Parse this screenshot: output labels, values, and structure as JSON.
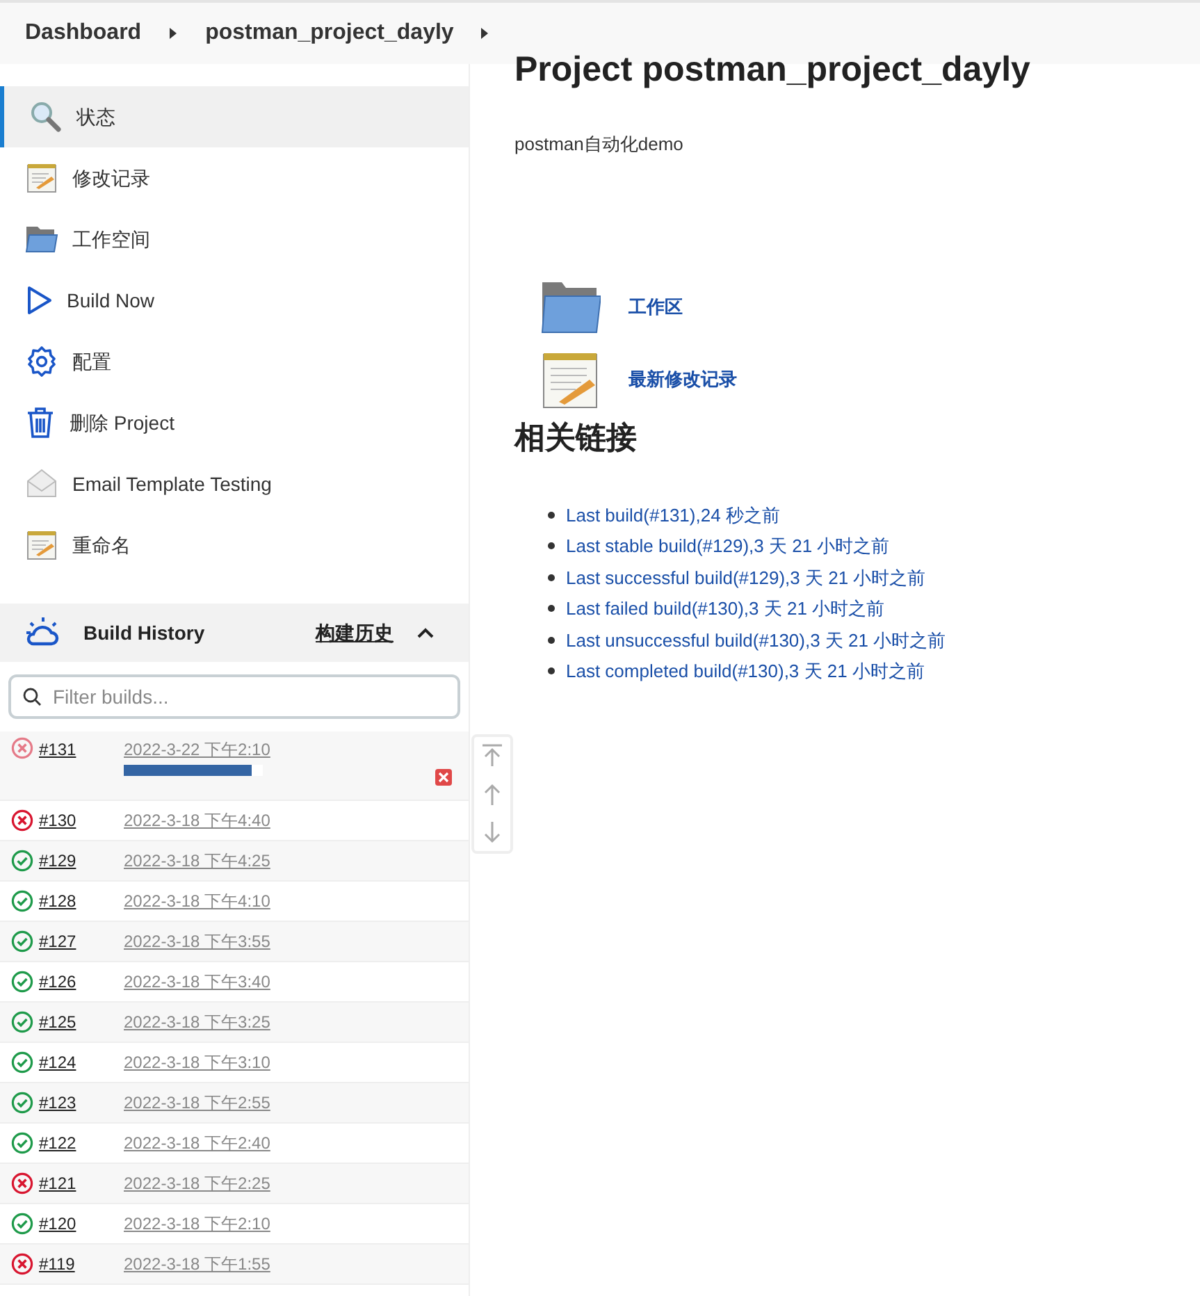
{
  "breadcrumb": [
    {
      "label": "Dashboard"
    },
    {
      "label": "postman_project_dayly"
    }
  ],
  "sidebar": {
    "items": [
      {
        "label": "状态",
        "selected": true
      },
      {
        "label": "修改记录",
        "selected": false
      },
      {
        "label": "工作空间",
        "selected": false
      },
      {
        "label": "Build Now",
        "selected": false
      },
      {
        "label": "配置",
        "selected": false
      },
      {
        "label": "删除 Project",
        "selected": false
      },
      {
        "label": "Email Template Testing",
        "selected": false
      },
      {
        "label": "重命名",
        "selected": false
      }
    ]
  },
  "build_history": {
    "title": "Build History",
    "link": "构建历史",
    "expanded": true,
    "filter": {
      "placeholder": "Filter builds..."
    },
    "builds": [
      {
        "number": "#131",
        "time": "2022-3-22 下午2:10",
        "kind": "failed",
        "running": true,
        "level": 0.92
      },
      {
        "number": "#130",
        "time": "2022-3-18 下午4:40",
        "kind": "failed",
        "running": false
      },
      {
        "number": "#129",
        "time": "2022-3-18 下午4:25",
        "kind": "success",
        "running": false
      },
      {
        "number": "#128",
        "time": "2022-3-18 下午4:10",
        "kind": "success",
        "running": false
      },
      {
        "number": "#127",
        "time": "2022-3-18 下午3:55",
        "kind": "success",
        "running": false
      },
      {
        "number": "#126",
        "time": "2022-3-18 下午3:40",
        "kind": "success",
        "running": false
      },
      {
        "number": "#125",
        "time": "2022-3-18 下午3:25",
        "kind": "success",
        "running": false
      },
      {
        "number": "#124",
        "time": "2022-3-18 下午3:10",
        "kind": "success",
        "running": false
      },
      {
        "number": "#123",
        "time": "2022-3-18 下午2:55",
        "kind": "success",
        "running": false
      },
      {
        "number": "#122",
        "time": "2022-3-18 下午2:40",
        "kind": "success",
        "running": false
      },
      {
        "number": "#121",
        "time": "2022-3-18 下午2:25",
        "kind": "failed",
        "running": false
      },
      {
        "number": "#120",
        "time": "2022-3-18 下午2:10",
        "kind": "success",
        "running": false
      },
      {
        "number": "#119",
        "time": "2022-3-18 下午1:55",
        "kind": "failed",
        "running": false
      }
    ]
  },
  "main": {
    "title": "Project postman_project_dayly",
    "description": "postman自动化demo",
    "shortcuts": [
      {
        "label": "工作区"
      },
      {
        "label": "最新修改记录"
      }
    ],
    "links_heading": "相关链接",
    "links": [
      "Last build(#131),24 秒之前",
      "Last stable build(#129),3 天 21 小时之前",
      "Last successful build(#129),3 天 21 小时之前",
      "Last failed build(#130),3 天 21 小时之前",
      "Last unsuccessful build(#130),3 天 21 小时之前",
      "Last completed build(#130),3 天 21 小时之前"
    ]
  }
}
